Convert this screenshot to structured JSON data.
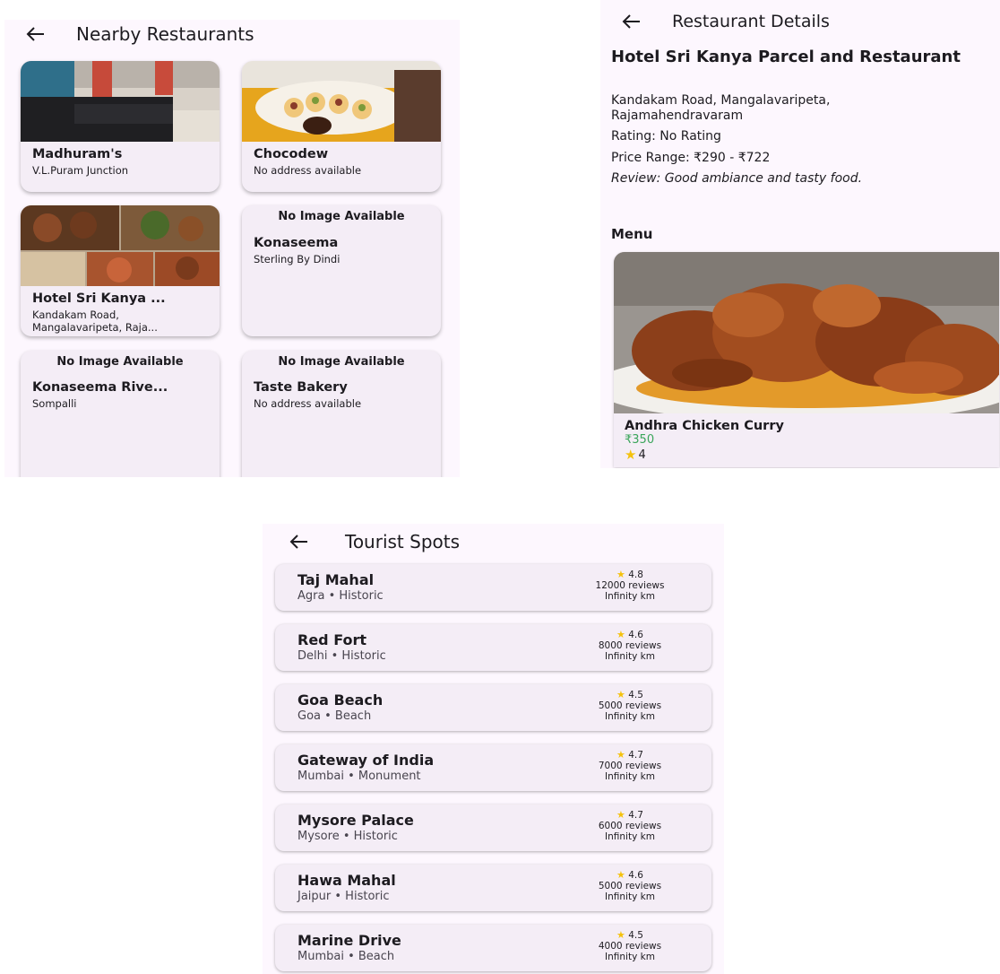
{
  "nearby": {
    "title": "Nearby Restaurants",
    "cards": [
      {
        "name": "Madhuram's",
        "address": "V.L.Puram Junction"
      },
      {
        "name": "Chocodew",
        "address": "No address available"
      },
      {
        "name": "Hotel Sri Kanya ...",
        "address": "Kandakam Road, Mangalavaripeta, Raja..."
      },
      {
        "no_image": "No Image Available",
        "name": "Konaseema",
        "address": "Sterling By Dindi"
      },
      {
        "no_image": "No Image Available",
        "name": "Konaseema Rive...",
        "address": "Sompalli"
      },
      {
        "no_image": "No Image Available",
        "name": "Taste Bakery",
        "address": "No address available"
      }
    ]
  },
  "details": {
    "title": "Restaurant Details",
    "name": "Hotel Sri Kanya Parcel and Restaurant",
    "address": "Kandakam Road, Mangalavaripeta, Rajamahendravaram",
    "rating": "Rating: No Rating",
    "price_range": "Price Range: ₹290 - ₹722",
    "review": "Review: Good ambiance and tasty food.",
    "menu_heading": "Menu",
    "menu_item": {
      "name": "Andhra Chicken Curry",
      "price": "₹350",
      "rating": "4"
    }
  },
  "tourist": {
    "title": "Tourist Spots",
    "spots": [
      {
        "name": "Taj Mahal",
        "sub": "Agra • Historic",
        "rating": "4.8",
        "reviews": "12000 reviews",
        "distance": "Infinity km"
      },
      {
        "name": "Red Fort",
        "sub": "Delhi • Historic",
        "rating": "4.6",
        "reviews": "8000 reviews",
        "distance": "Infinity km"
      },
      {
        "name": "Goa Beach",
        "sub": "Goa • Beach",
        "rating": "4.5",
        "reviews": "5000 reviews",
        "distance": "Infinity km"
      },
      {
        "name": "Gateway of India",
        "sub": "Mumbai • Monument",
        "rating": "4.7",
        "reviews": "7000 reviews",
        "distance": "Infinity km"
      },
      {
        "name": "Mysore Palace",
        "sub": "Mysore • Historic",
        "rating": "4.7",
        "reviews": "6000 reviews",
        "distance": "Infinity km"
      },
      {
        "name": "Hawa Mahal",
        "sub": "Jaipur • Historic",
        "rating": "4.6",
        "reviews": "5000 reviews",
        "distance": "Infinity km"
      },
      {
        "name": "Marine Drive",
        "sub": "Mumbai • Beach",
        "rating": "4.5",
        "reviews": "4000 reviews",
        "distance": "Infinity km"
      }
    ]
  },
  "colors": {
    "background": "#fdf7fe",
    "card": "#f4edf6",
    "price_green": "#3aa55a",
    "star": "#f4c20d"
  }
}
